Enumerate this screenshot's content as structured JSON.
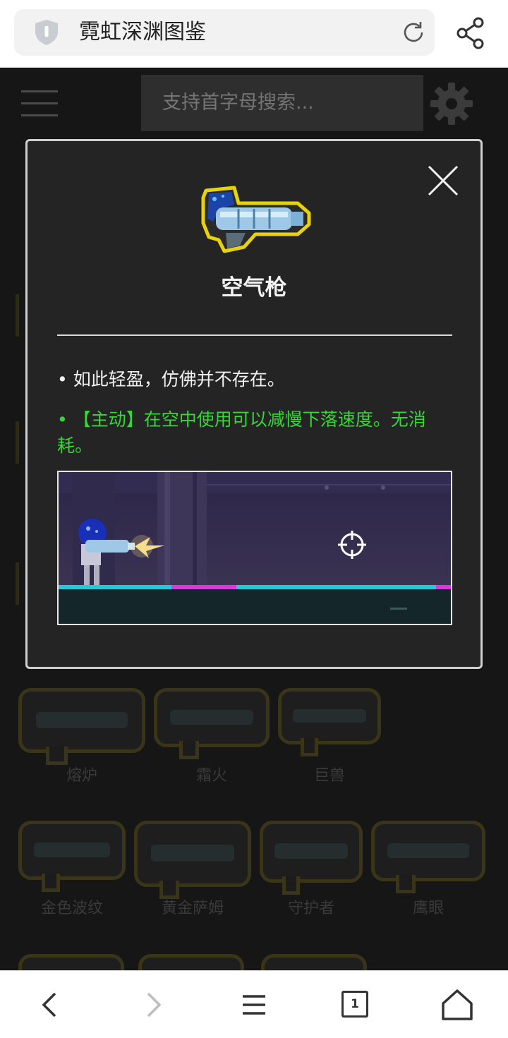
{
  "browser": {
    "title": "霓虹深渊图鉴",
    "shield_icon": "shield-icon",
    "reload_icon": "reload-icon",
    "share_icon": "share-icon"
  },
  "page": {
    "search": {
      "placeholder": "支持首字母搜索...",
      "value": ""
    },
    "menu_icon": "hamburger-menu-icon",
    "settings_icon": "gear-icon",
    "weapons": [
      {
        "name": "熔炉"
      },
      {
        "name": "霜火"
      },
      {
        "name": "巨兽"
      },
      {
        "name": "金色波纹"
      },
      {
        "name": "黄金萨姆"
      },
      {
        "name": "守护者"
      },
      {
        "name": "鹰眼"
      }
    ]
  },
  "modal": {
    "item_name": "空气枪",
    "description": "• 如此轻盈，仿佛并不存在。",
    "active_effect": "• 【主动】在空中使用可以减慢下落速度。无消耗。",
    "close_icon": "close-icon",
    "accent_green": "#36d736"
  },
  "bottom_nav": {
    "tab_count": "1",
    "icons": [
      "back-icon",
      "forward-icon",
      "menu-icon",
      "tabs-icon",
      "home-icon"
    ]
  }
}
